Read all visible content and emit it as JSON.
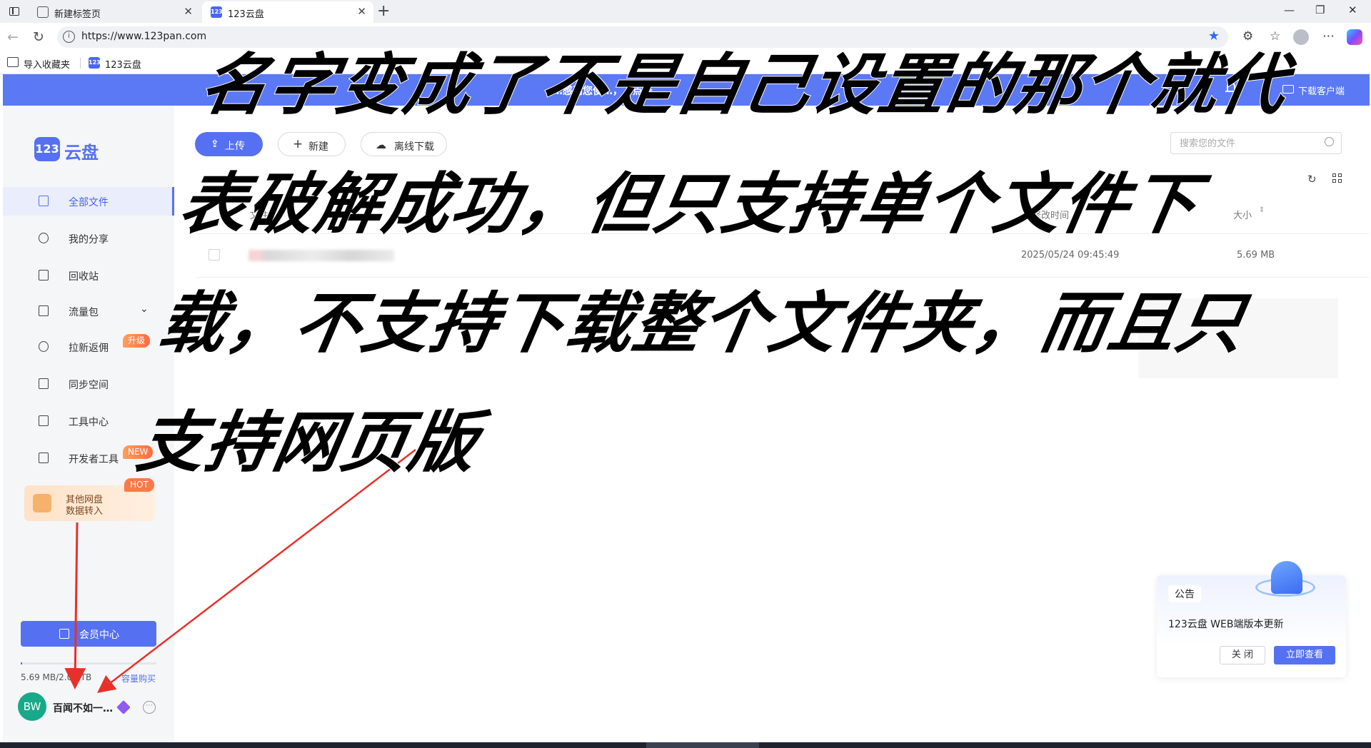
{
  "browser": {
    "tabs": [
      {
        "label": "新建标签页",
        "active": false
      },
      {
        "label": "123云盘",
        "active": true,
        "favicon_text": "123"
      }
    ],
    "url": "https://www.123pan.com",
    "bookmarks": [
      {
        "label": "导入收藏夹"
      },
      {
        "label": "123云盘",
        "favicon_text": "123"
      }
    ]
  },
  "banner": {
    "text": "…感谢您使…，…点击…",
    "download_client": "下载客户端"
  },
  "sidebar": {
    "logo_box": "123",
    "logo_text": "云盘",
    "items": [
      {
        "label": "全部文件",
        "icon": "file-icon",
        "active": true
      },
      {
        "label": "我的分享",
        "icon": "share-icon"
      },
      {
        "label": "回收站",
        "icon": "trash-icon"
      },
      {
        "label": "流量包",
        "icon": "chart-icon",
        "expandable": true
      },
      {
        "label": "拉新返佣",
        "icon": "yen-icon",
        "badge": "升级"
      },
      {
        "label": "同步空间",
        "icon": "sync-icon"
      },
      {
        "label": "工具中心",
        "icon": "toolbox-icon"
      },
      {
        "label": "开发者工具",
        "icon": "terminal-icon",
        "badge": "NEW"
      }
    ],
    "promo": {
      "line1": "其他网盘",
      "line2": "数据转入",
      "badge": "HOT"
    },
    "vip_button": "会员中心",
    "usage_text": "5.69 MB/2.00 TB",
    "buy_link": "容量购买",
    "user": {
      "avatar_initials": "BW",
      "name": "百闻不如一…"
    }
  },
  "main": {
    "buttons": {
      "upload": "上传",
      "new": "新建",
      "offline_download": "离线下载"
    },
    "search_placeholder": "搜索您的文件",
    "columns": {
      "name": "文件名",
      "modified": "修改时间",
      "size": "大小"
    },
    "files": [
      {
        "date": "2025/05/24 09:45:49",
        "size": "5.69 MB"
      }
    ]
  },
  "notice": {
    "tag": "公告",
    "text": "123云盘 WEB端版本更新",
    "close": "关 闭",
    "view": "立即查看"
  },
  "overlay": {
    "lines": [
      "名字变成了不是自己设置的那个就代",
      "表破解成功，但只支持单个文件下",
      "载，不支持下载整个文件夹，而且只",
      "支持网页版"
    ],
    "color": "#000000"
  },
  "colors": {
    "accent": "#5571f2",
    "annotation_arrow": "#e8302a"
  }
}
